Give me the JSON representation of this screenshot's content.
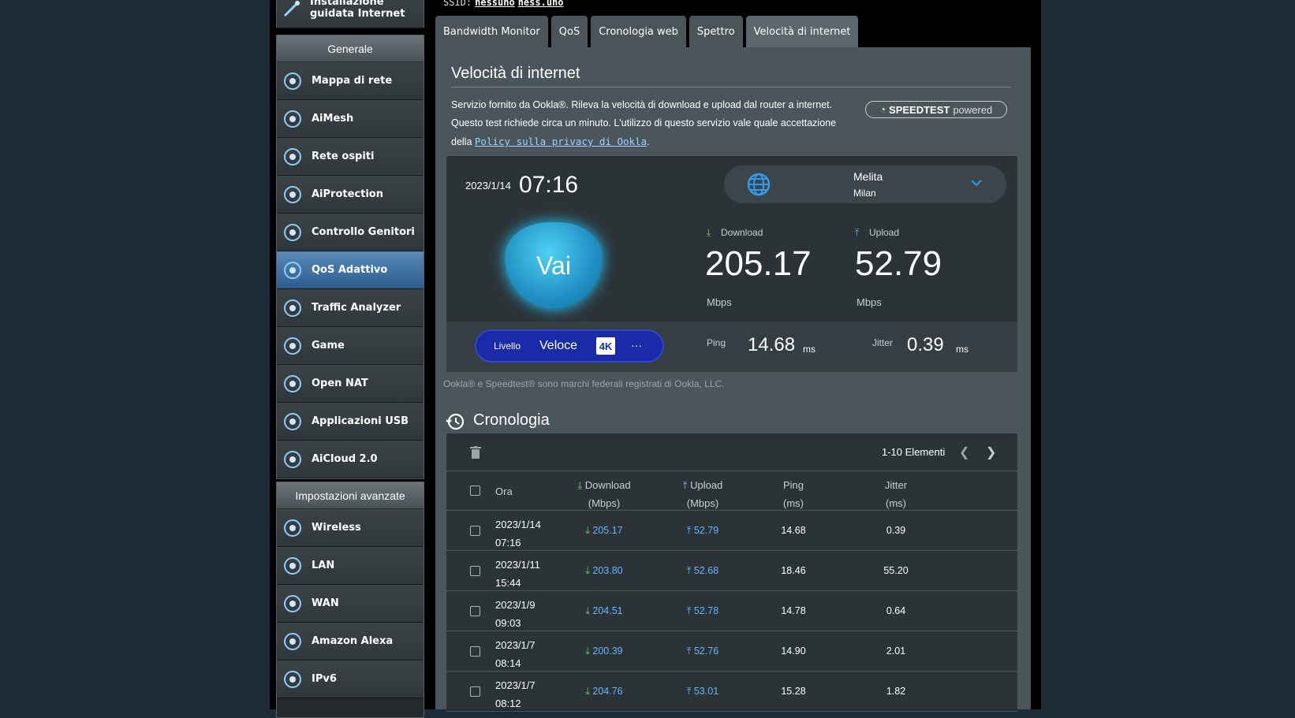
{
  "ssid": {
    "label": "SSID:",
    "values": [
      "nessuno",
      "ness.uno"
    ]
  },
  "sidebar": {
    "top_item": "Installazione guidata Internet",
    "general_title": "Generale",
    "general": [
      {
        "label": "Mappa di rete",
        "icon": "network-map-icon"
      },
      {
        "label": "AiMesh",
        "icon": "aimesh-icon"
      },
      {
        "label": "Rete ospiti",
        "icon": "guest-network-icon"
      },
      {
        "label": "AiProtection",
        "icon": "shield-icon"
      },
      {
        "label": "Controllo Genitori",
        "icon": "parental-control-icon"
      },
      {
        "label": "QoS Adattivo",
        "icon": "qos-icon"
      },
      {
        "label": "Traffic Analyzer",
        "icon": "traffic-analyzer-icon"
      },
      {
        "label": "Game",
        "icon": "gamepad-icon"
      },
      {
        "label": "Open NAT",
        "icon": "open-nat-icon"
      },
      {
        "label": "Applicazioni USB",
        "icon": "usb-icon"
      },
      {
        "label": "AiCloud 2.0",
        "icon": "cloud-icon"
      }
    ],
    "advanced_title": "Impostazioni avanzate",
    "advanced": [
      {
        "label": "Wireless",
        "icon": "wireless-icon"
      },
      {
        "label": "LAN",
        "icon": "lan-icon"
      },
      {
        "label": "WAN",
        "icon": "wan-icon"
      },
      {
        "label": "Amazon Alexa",
        "icon": "alexa-icon"
      },
      {
        "label": "IPv6",
        "icon": "ipv6-icon"
      }
    ]
  },
  "tabs": [
    "Bandwidth Monitor",
    "QoS",
    "Cronologia web",
    "Spettro",
    "Velocità di internet"
  ],
  "page": {
    "title": "Velocità di internet",
    "desc1": "Servizio fornito da Ookla®. Rileva la velocità di download e upload dal router a internet.",
    "desc2": "Questo test richiede circa un minuto. L'utilizzo di questo servizio vale quale accettazione",
    "desc3_pre": "della ",
    "privacy_link": "Policy sulla privacy di Ookla",
    "badge_main": "SPEEDTEST",
    "badge_sub": "powered"
  },
  "test": {
    "date": "2023/1/14",
    "time": "07:16",
    "server_name": "Melita",
    "server_city": "Milan",
    "go": "Vai",
    "download_label": "Download",
    "upload_label": "Upload",
    "download": "205.17",
    "upload": "52.79",
    "unit": "Mbps",
    "ping_label": "Ping",
    "ping": "14.68",
    "jitter_label": "Jitter",
    "jitter": "0.39",
    "ms": "ms",
    "level_label": "Livello",
    "level_value": "Veloce",
    "level_badge": "4K",
    "level_more": "···"
  },
  "trademark": "Ookla® e Speedtest® sono marchi federali registrati di Ookla, LLC.",
  "history": {
    "title": "Cronologia",
    "count": "1-10 Elementi",
    "headers": {
      "ora": "Ora",
      "dl": "Download",
      "dl_unit": "(Mbps)",
      "ul": "Upload",
      "ul_unit": "(Mbps)",
      "ping": "Ping",
      "ping_unit": "(ms)",
      "jitter": "Jitter",
      "jitter_unit": "(ms)"
    },
    "rows": [
      {
        "date": "2023/1/14",
        "time": "07:16",
        "dl": "205.17",
        "ul": "52.79",
        "ping": "14.68",
        "jitter": "0.39"
      },
      {
        "date": "2023/1/11",
        "time": "15:44",
        "dl": "203.80",
        "ul": "52.68",
        "ping": "18.46",
        "jitter": "55.20"
      },
      {
        "date": "2023/1/9",
        "time": "09:03",
        "dl": "204.51",
        "ul": "52.78",
        "ping": "14.78",
        "jitter": "0.64"
      },
      {
        "date": "2023/1/7",
        "time": "08:14",
        "dl": "200.39",
        "ul": "52.76",
        "ping": "14.90",
        "jitter": "2.01"
      },
      {
        "date": "2023/1/7",
        "time": "08:12",
        "dl": "204.76",
        "ul": "53.01",
        "ping": "15.28",
        "jitter": "1.82"
      }
    ]
  }
}
